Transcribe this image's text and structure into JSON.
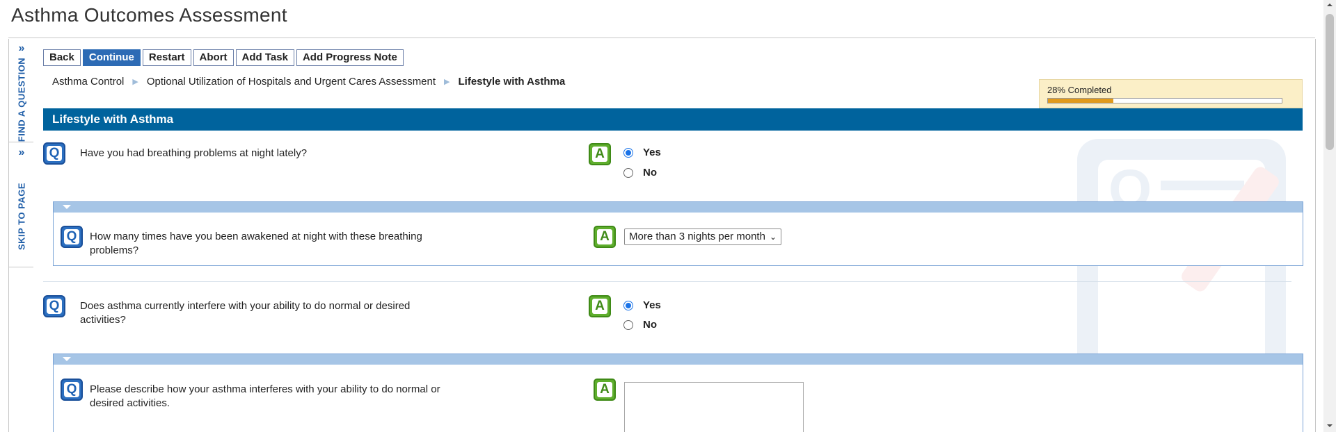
{
  "page": {
    "title": "Asthma Outcomes Assessment"
  },
  "rail": {
    "find_question": "FIND A QUESTION",
    "skip_to_page": "SKIP TO PAGE"
  },
  "toolbar": {
    "back": "Back",
    "continue": "Continue",
    "restart": "Restart",
    "abort": "Abort",
    "add_task": "Add Task",
    "add_progress_note": "Add Progress Note"
  },
  "breadcrumb": [
    "Asthma Control",
    "Optional Utilization of Hospitals and Urgent Cares Assessment",
    "Lifestyle with Asthma"
  ],
  "progress": {
    "label": "28% Completed",
    "percent": 28
  },
  "section": {
    "title": "Lifestyle with Asthma"
  },
  "icons": {
    "question": "Q",
    "answer": "A"
  },
  "questions": [
    {
      "text": "Have you had breathing problems at night lately?",
      "options": [
        "Yes",
        "No"
      ],
      "selected": "Yes"
    },
    {
      "text": "How many times have you been awakened at night with these breathing problems?",
      "selected_value": "More than 3 nights per month"
    },
    {
      "text": "Does asthma currently interfere with your ability to do normal or desired activities?",
      "options": [
        "Yes",
        "No"
      ],
      "selected": "Yes"
    },
    {
      "text": "Please describe how your asthma interferes with your ability to do normal or desired activities.",
      "value": ""
    }
  ],
  "colors": {
    "section_bar": "#00639d",
    "primary_button": "#2d6bb5",
    "progress_fill": "#e09a1c",
    "sub_header": "#a6c5e6"
  }
}
